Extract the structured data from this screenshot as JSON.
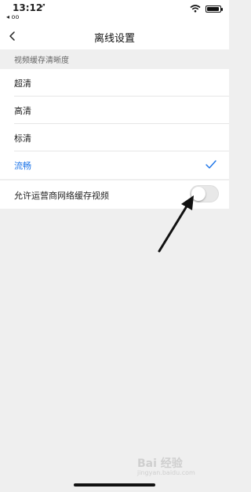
{
  "status": {
    "time": "13:12",
    "back_app": "◂ oo"
  },
  "nav": {
    "title": "离线设置"
  },
  "section": {
    "title": "视频缓存清晰度"
  },
  "quality_options": [
    {
      "label": "超清",
      "selected": false
    },
    {
      "label": "高清",
      "selected": false
    },
    {
      "label": "标清",
      "selected": false
    },
    {
      "label": "流畅",
      "selected": true
    }
  ],
  "toggle": {
    "label": "允许运营商网络缓存视频",
    "enabled": false
  },
  "colors": {
    "accent": "#1a73e8",
    "background": "#efefef"
  },
  "watermark": {
    "text": "Bai 经验",
    "sub": "jingyan.baidu.com"
  }
}
